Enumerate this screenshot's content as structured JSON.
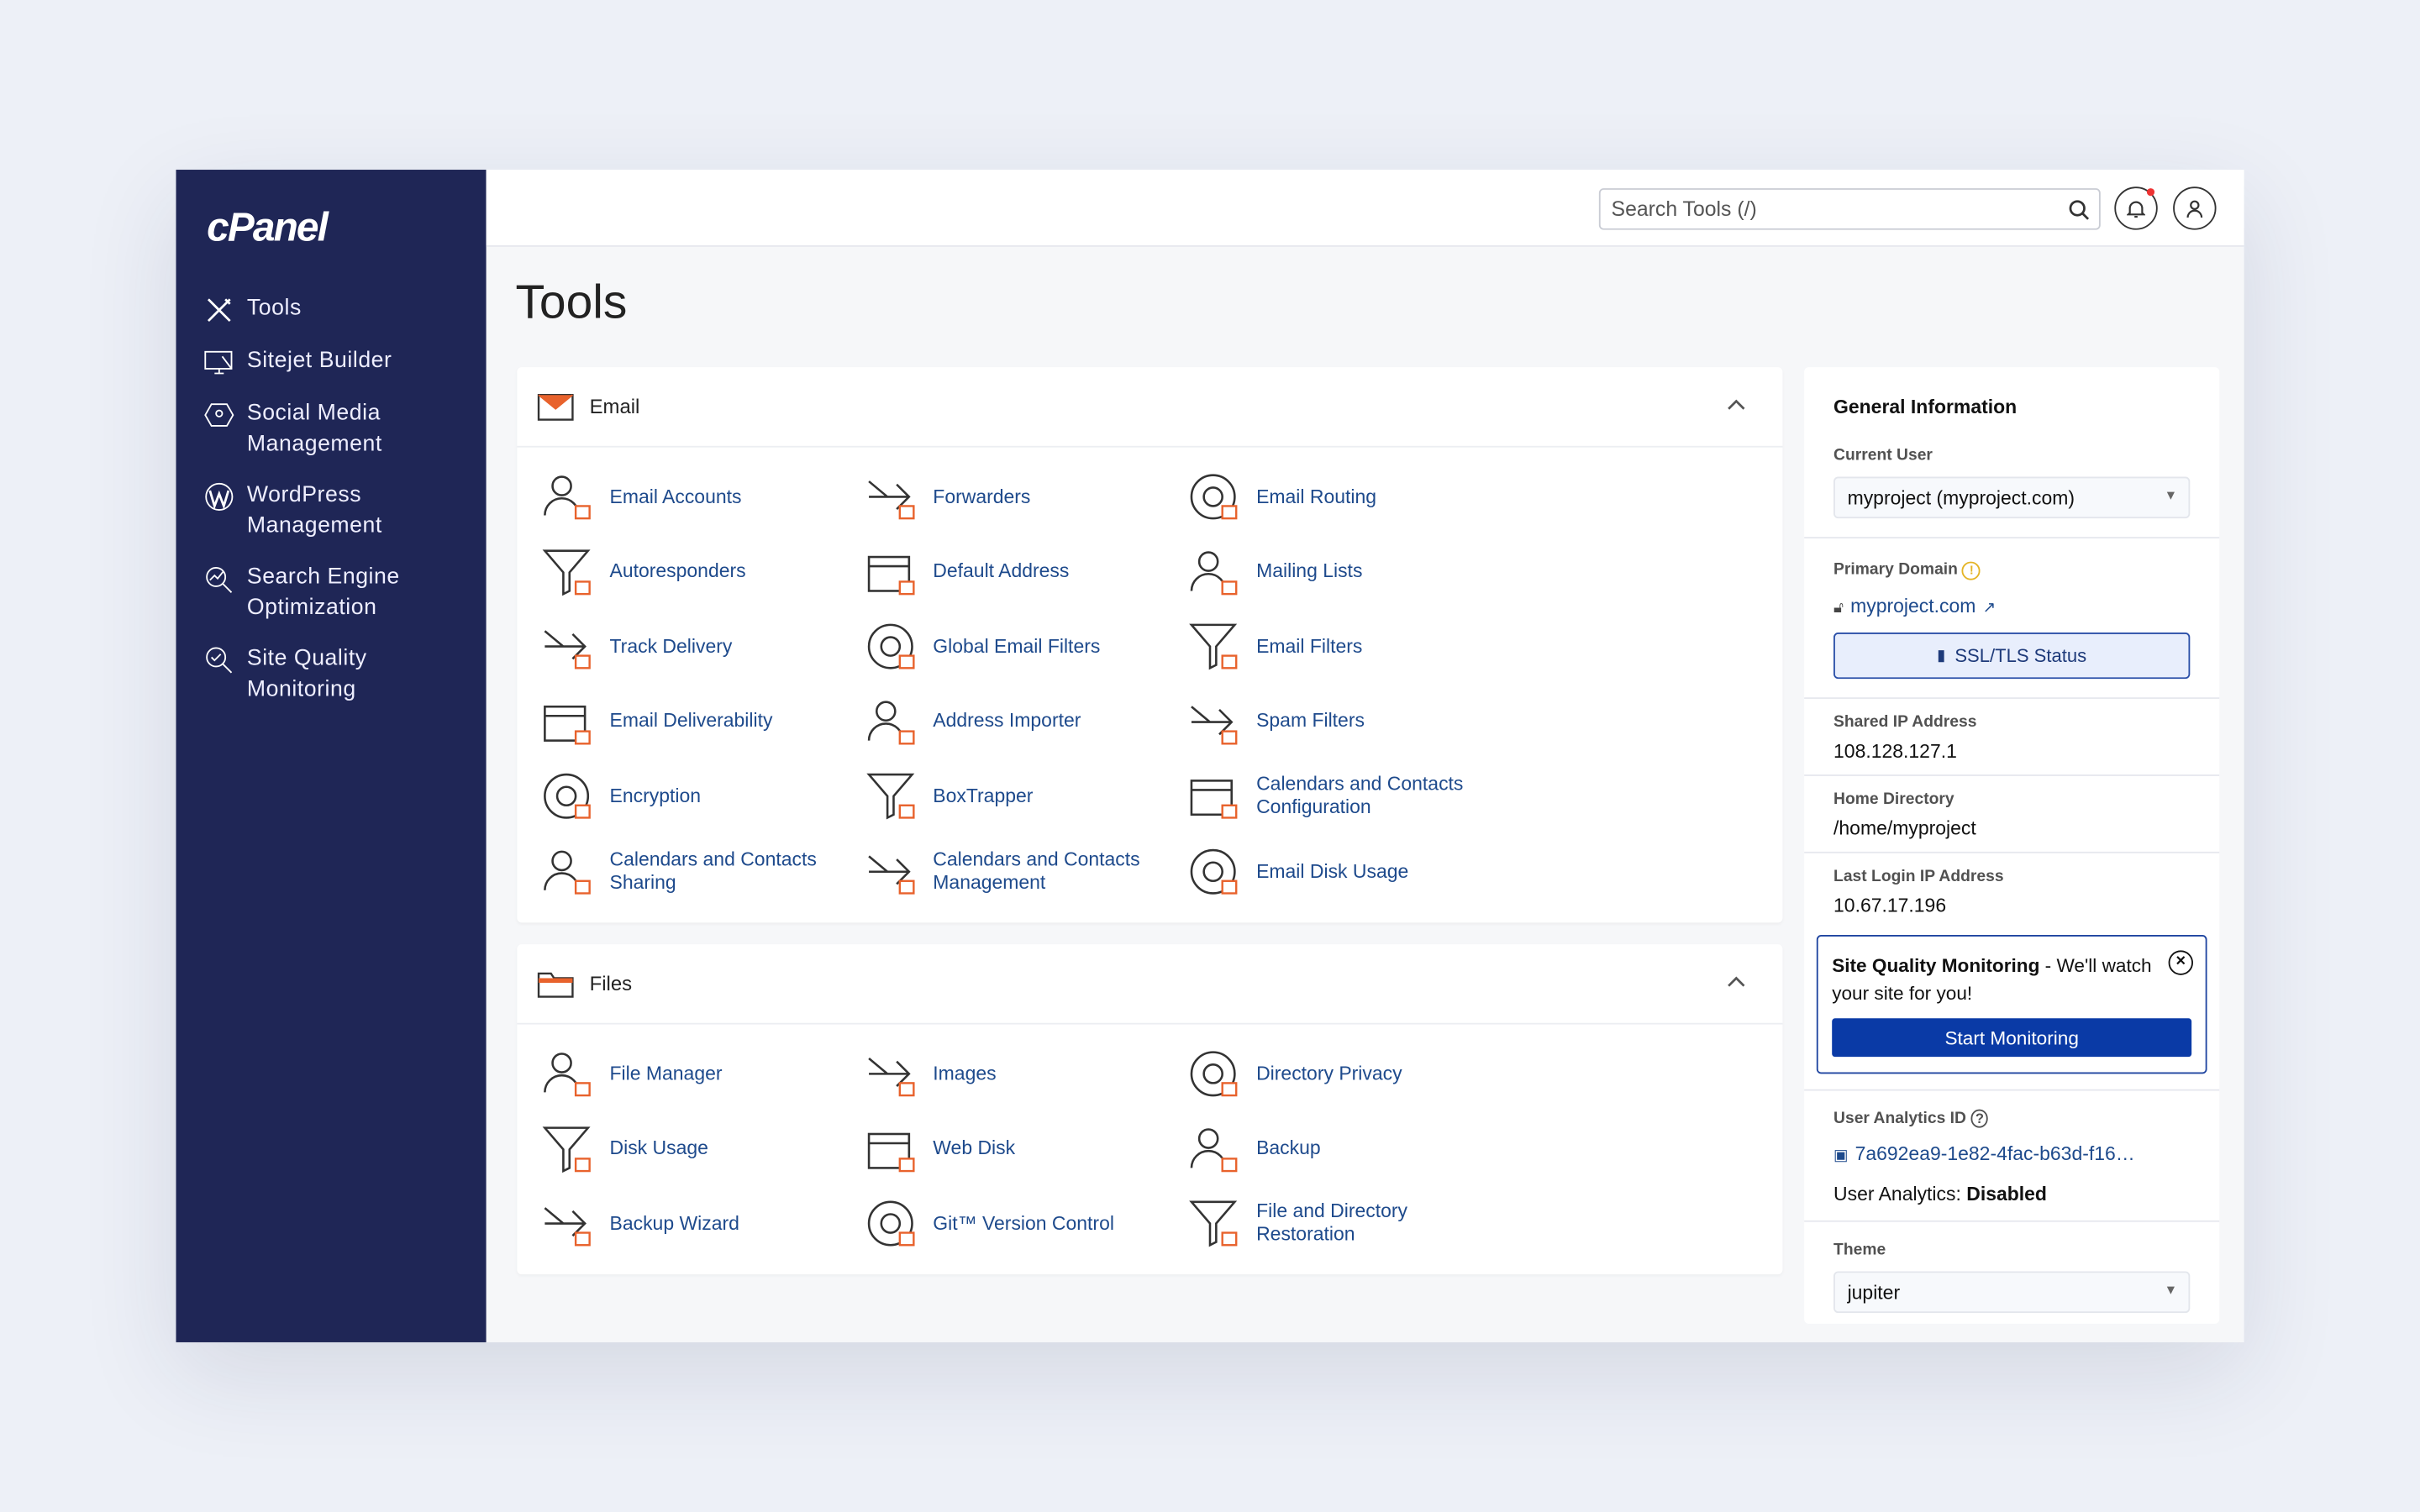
{
  "logo": "cPanel",
  "sidebar": {
    "items": [
      {
        "label": "Tools"
      },
      {
        "label": "Sitejet Builder"
      },
      {
        "label": "Social Media Management"
      },
      {
        "label": "WordPress Management"
      },
      {
        "label": "Search Engine Optimization"
      },
      {
        "label": "Site Quality Monitoring"
      }
    ]
  },
  "header": {
    "search_placeholder": "Search Tools (/)"
  },
  "page_title": "Tools",
  "email": {
    "title": "Email",
    "tools": [
      "Email Accounts",
      "Forwarders",
      "Email Routing",
      "Autoresponders",
      "Default Address",
      "Mailing Lists",
      "Track Delivery",
      "Global Email Filters",
      "Email Filters",
      "Email Deliverability",
      "Address Importer",
      "Spam Filters",
      "Encryption",
      "BoxTrapper",
      "Calendars and Contacts Configuration",
      "Calendars and Contacts Sharing",
      "Calendars and Contacts Management",
      "Email Disk Usage"
    ]
  },
  "files": {
    "title": "Files",
    "tools": [
      "File Manager",
      "Images",
      "Directory Privacy",
      "Disk Usage",
      "Web Disk",
      "Backup",
      "Backup Wizard",
      "Git™ Version Control",
      "File and Directory Restoration"
    ]
  },
  "info": {
    "title": "General Information",
    "current_user_label": "Current User",
    "current_user": "myproject (myproject.com)",
    "primary_domain_label": "Primary Domain",
    "primary_domain": "myproject.com",
    "ssl_button": "SSL/TLS Status",
    "shared_ip_label": "Shared IP Address",
    "shared_ip": "108.128.127.1",
    "home_dir_label": "Home Directory",
    "home_dir": "/home/myproject",
    "last_login_label": "Last Login IP Address",
    "last_login": "10.67.17.196",
    "sqm_title": "Site Quality Monitoring",
    "sqm_text": " - We'll watch your site for you!",
    "sqm_button": "Start Monitoring",
    "analytics_id_label": "User Analytics ID",
    "analytics_id": "7a692ea9-1e82-4fac-b63d-f16…",
    "analytics_label": "User Analytics: ",
    "analytics_value": "Disabled",
    "theme_label": "Theme",
    "theme": "jupiter"
  },
  "colors": {
    "sidebar": "#1f2656",
    "accent": "#e8622c",
    "link": "#1e4a8c",
    "primary": "#0a3aa6"
  }
}
